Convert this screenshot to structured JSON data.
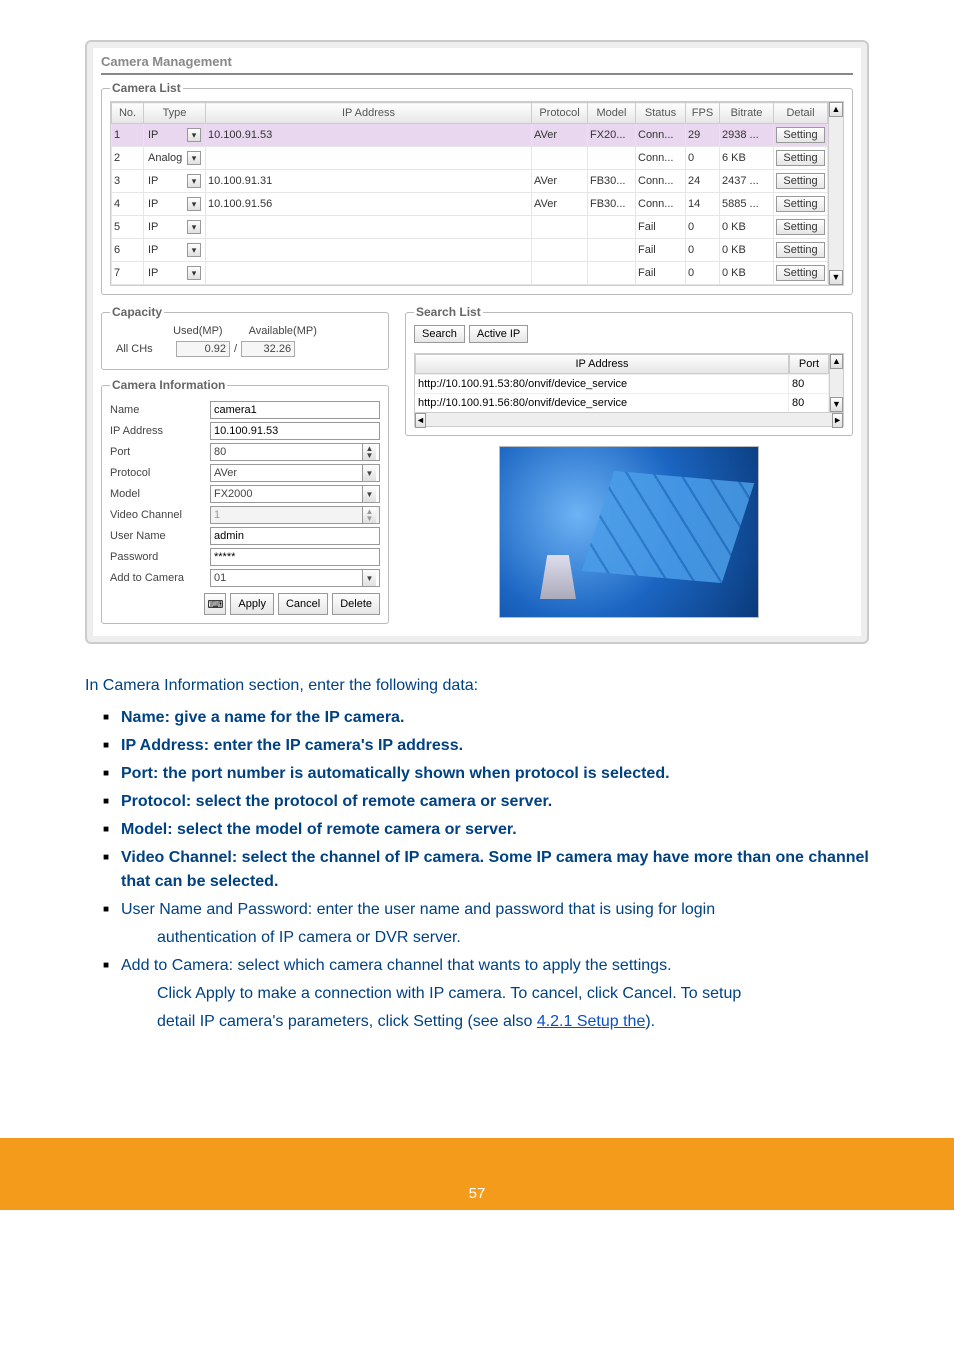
{
  "cm_title": "Camera Management",
  "camera_list": {
    "legend": "Camera List",
    "headers": [
      "No.",
      "Type",
      "IP Address",
      "Protocol",
      "Model",
      "Status",
      "FPS",
      "Bitrate",
      "Detail"
    ],
    "rows": [
      {
        "no": "1",
        "type": "IP",
        "ip": "10.100.91.53",
        "protocol": "AVer",
        "model": "FX20...",
        "status": "Conn...",
        "fps": "29",
        "bitrate": "2938 ...",
        "detail": "Setting",
        "sel": true
      },
      {
        "no": "2",
        "type": "Analog",
        "ip": "",
        "protocol": "",
        "model": "",
        "status": "Conn...",
        "fps": "0",
        "bitrate": "6 KB",
        "detail": "Setting"
      },
      {
        "no": "3",
        "type": "IP",
        "ip": "10.100.91.31",
        "protocol": "AVer",
        "model": "FB30...",
        "status": "Conn...",
        "fps": "24",
        "bitrate": "2437 ...",
        "detail": "Setting"
      },
      {
        "no": "4",
        "type": "IP",
        "ip": "10.100.91.56",
        "protocol": "AVer",
        "model": "FB30...",
        "status": "Conn...",
        "fps": "14",
        "bitrate": "5885 ...",
        "detail": "Setting"
      },
      {
        "no": "5",
        "type": "IP",
        "ip": "",
        "protocol": "",
        "model": "",
        "status": "Fail",
        "fps": "0",
        "bitrate": "0 KB",
        "detail": "Setting"
      },
      {
        "no": "6",
        "type": "IP",
        "ip": "",
        "protocol": "",
        "model": "",
        "status": "Fail",
        "fps": "0",
        "bitrate": "0 KB",
        "detail": "Setting"
      },
      {
        "no": "7",
        "type": "IP",
        "ip": "",
        "protocol": "",
        "model": "",
        "status": "Fail",
        "fps": "0",
        "bitrate": "0 KB",
        "detail": "Setting"
      }
    ]
  },
  "capacity": {
    "legend": "Capacity",
    "used_lbl": "Used(MP)",
    "avail_lbl": "Available(MP)",
    "allchs": "All CHs",
    "used": "0.92",
    "sep": "/",
    "avail": "32.26"
  },
  "caminfo": {
    "legend": "Camera Information",
    "labels": {
      "name": "Name",
      "ip": "IP Address",
      "port": "Port",
      "protocol": "Protocol",
      "model": "Model",
      "vchan": "Video Channel",
      "user": "User Name",
      "pwd": "Password",
      "addto": "Add to Camera"
    },
    "values": {
      "name": "camera1",
      "ip": "10.100.91.53",
      "port": "80",
      "protocol": "AVer",
      "model": "FX2000",
      "vchan": "1",
      "user": "admin",
      "pwd": "*****",
      "addto": "01"
    },
    "buttons": {
      "apply": "Apply",
      "cancel": "Cancel",
      "delete": "Delete"
    }
  },
  "searchlist": {
    "legend": "Search List",
    "btn_search": "Search",
    "btn_activeip": "Active IP",
    "headers": {
      "ip": "IP Address",
      "port": "Port"
    },
    "rows": [
      {
        "ip": "http://10.100.91.53:80/onvif/device_service",
        "port": "80"
      },
      {
        "ip": "http://10.100.91.56:80/onvif/device_service",
        "port": "80"
      }
    ]
  },
  "doc": {
    "intro": "In Camera Information section, enter the following data:",
    "items": [
      "Name: give a name for the IP camera.",
      "IP Address: enter the IP camera's IP address.",
      "Port: the port number is automatically shown when protocol is selected.",
      "Protocol: select the protocol of remote camera or server.",
      "Model: select the model of remote camera or server.",
      "Video Channel: select the channel of IP camera. Some IP camera may have more than one channel that can be selected."
    ],
    "item_user_a": "User Name and Password: enter the user name and password that is using for login",
    "item_user_b": "authentication of IP camera or DVR server.",
    "item_addto_a": "Add to Camera: select which camera channel that wants to apply the settings.",
    "item_addto_b": "Click Apply to make a connection with IP camera. To cancel, click Cancel. To setup",
    "item_addto_c": "detail IP camera's parameters, click Setting (see also ",
    "link_text": "4.2.1 Setup the",
    "item_addto_d": ")."
  },
  "footer": "57"
}
